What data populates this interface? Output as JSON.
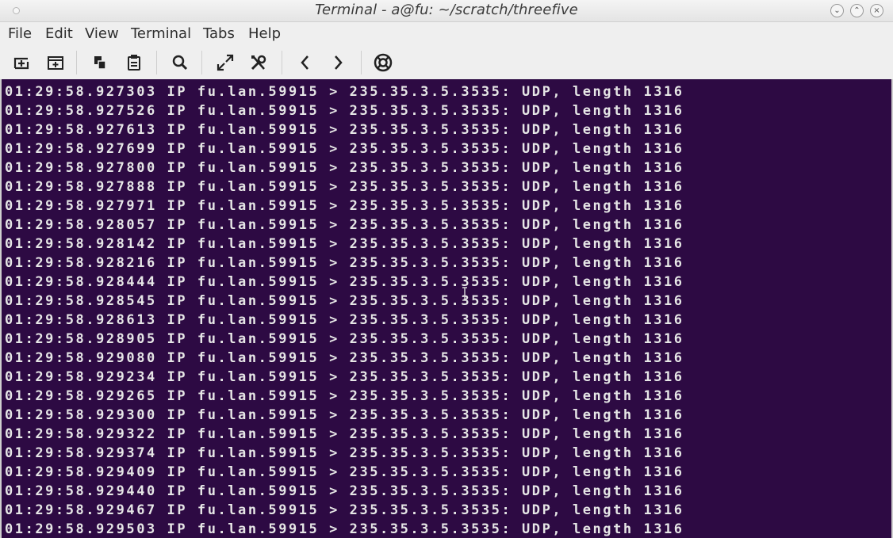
{
  "window": {
    "title": "Terminal - a@fu: ~/scratch/threefive",
    "controls": {
      "minimize_glyph": "⌄",
      "maximize_glyph": "⌃",
      "close_glyph": "×"
    }
  },
  "menubar": {
    "items": [
      "File",
      "Edit",
      "View",
      "Terminal",
      "Tabs",
      "Help"
    ]
  },
  "toolbar": {
    "buttons": [
      {
        "icon": "new-tab-icon"
      },
      {
        "icon": "new-window-icon"
      },
      {
        "icon": "copy-icon"
      },
      {
        "icon": "paste-icon"
      },
      {
        "icon": "search-icon"
      },
      {
        "icon": "fullscreen-icon"
      },
      {
        "icon": "preferences-icon"
      },
      {
        "icon": "previous-tab-icon"
      },
      {
        "icon": "next-tab-icon"
      },
      {
        "icon": "help-icon"
      }
    ]
  },
  "terminal": {
    "background": "#2d0a43",
    "foreground": "#e6e6e6",
    "lines": [
      "01:29:58.927303 IP fu.lan.59915 > 235.35.3.5.3535: UDP, length 1316",
      "01:29:58.927526 IP fu.lan.59915 > 235.35.3.5.3535: UDP, length 1316",
      "01:29:58.927613 IP fu.lan.59915 > 235.35.3.5.3535: UDP, length 1316",
      "01:29:58.927699 IP fu.lan.59915 > 235.35.3.5.3535: UDP, length 1316",
      "01:29:58.927800 IP fu.lan.59915 > 235.35.3.5.3535: UDP, length 1316",
      "01:29:58.927888 IP fu.lan.59915 > 235.35.3.5.3535: UDP, length 1316",
      "01:29:58.927971 IP fu.lan.59915 > 235.35.3.5.3535: UDP, length 1316",
      "01:29:58.928057 IP fu.lan.59915 > 235.35.3.5.3535: UDP, length 1316",
      "01:29:58.928142 IP fu.lan.59915 > 235.35.3.5.3535: UDP, length 1316",
      "01:29:58.928216 IP fu.lan.59915 > 235.35.3.5.3535: UDP, length 1316",
      "01:29:58.928444 IP fu.lan.59915 > 235.35.3.5.3535: UDP, length 1316",
      "01:29:58.928545 IP fu.lan.59915 > 235.35.3.5.3535: UDP, length 1316",
      "01:29:58.928613 IP fu.lan.59915 > 235.35.3.5.3535: UDP, length 1316",
      "01:29:58.928905 IP fu.lan.59915 > 235.35.3.5.3535: UDP, length 1316",
      "01:29:58.929080 IP fu.lan.59915 > 235.35.3.5.3535: UDP, length 1316",
      "01:29:58.929234 IP fu.lan.59915 > 235.35.3.5.3535: UDP, length 1316",
      "01:29:58.929265 IP fu.lan.59915 > 235.35.3.5.3535: UDP, length 1316",
      "01:29:58.929300 IP fu.lan.59915 > 235.35.3.5.3535: UDP, length 1316",
      "01:29:58.929322 IP fu.lan.59915 > 235.35.3.5.3535: UDP, length 1316",
      "01:29:58.929374 IP fu.lan.59915 > 235.35.3.5.3535: UDP, length 1316",
      "01:29:58.929409 IP fu.lan.59915 > 235.35.3.5.3535: UDP, length 1316",
      "01:29:58.929440 IP fu.lan.59915 > 235.35.3.5.3535: UDP, length 1316",
      "01:29:58.929467 IP fu.lan.59915 > 235.35.3.5.3535: UDP, length 1316",
      "01:29:58.929503 IP fu.lan.59915 > 235.35.3.5.3535: UDP, length 1316"
    ]
  }
}
